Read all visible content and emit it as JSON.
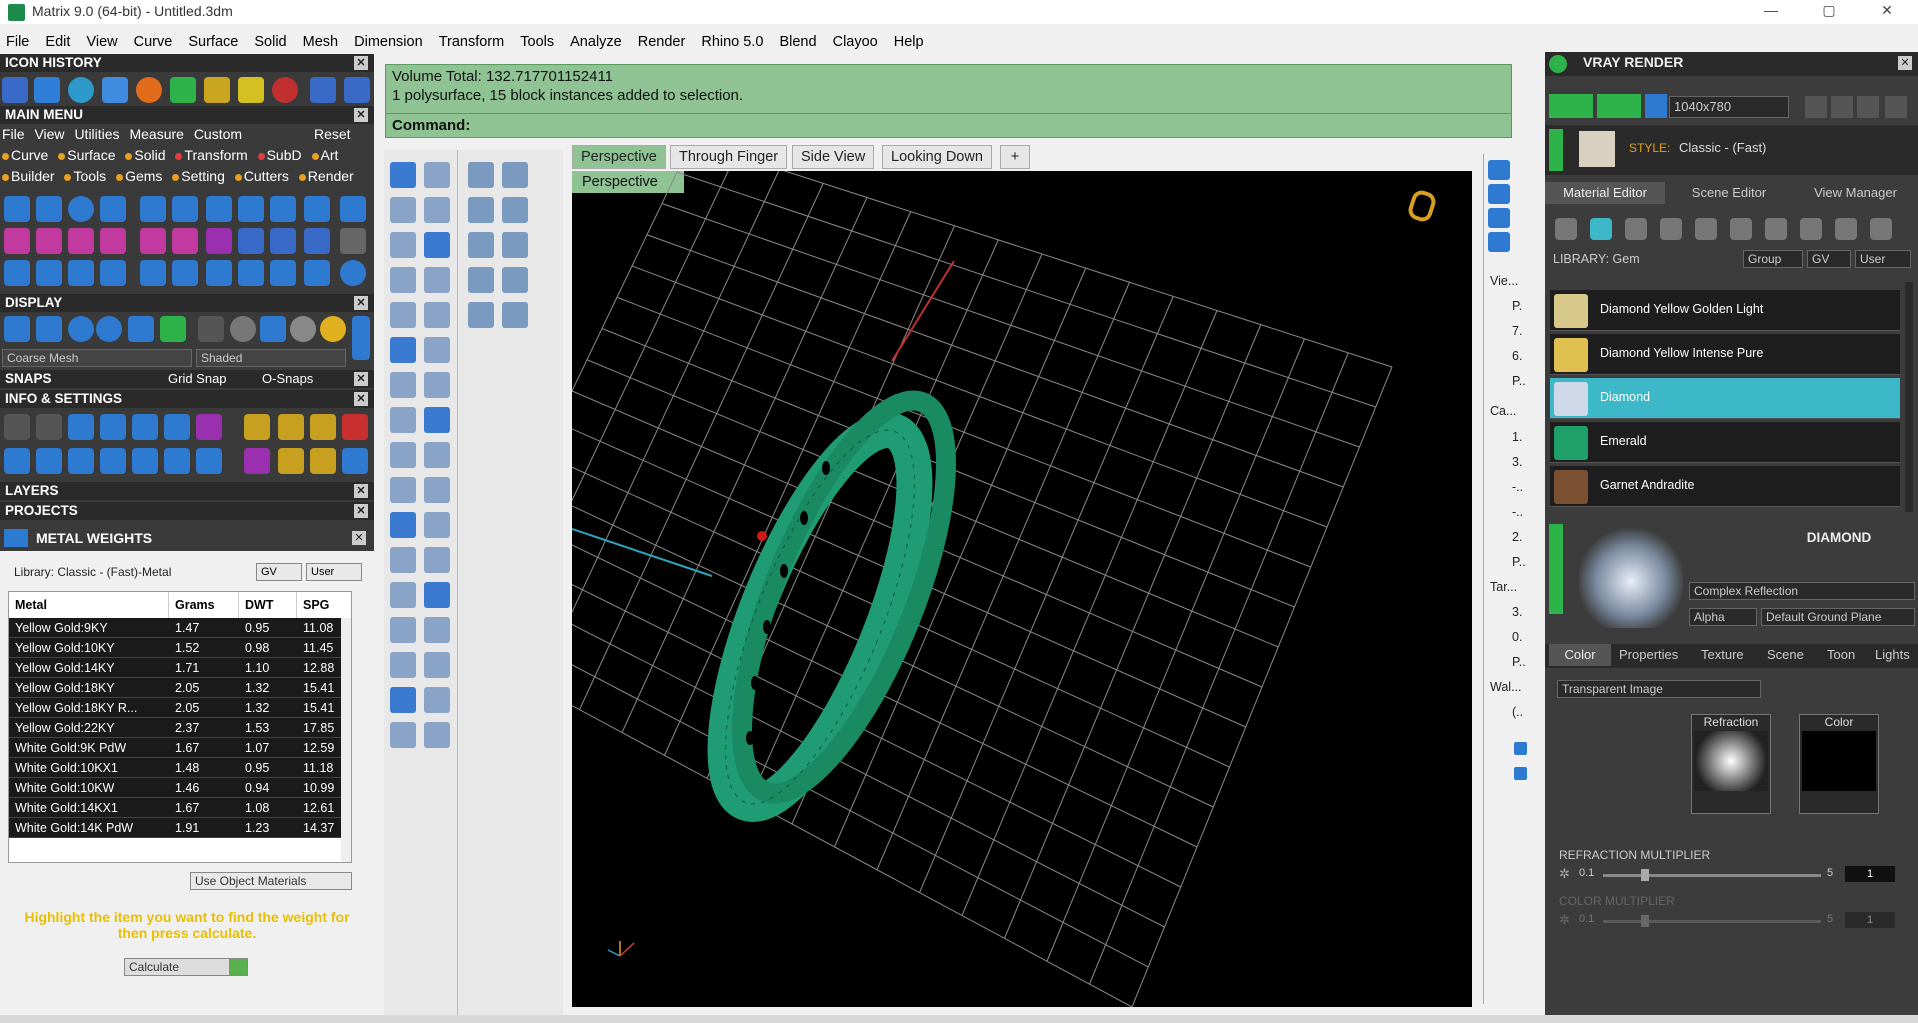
{
  "window": {
    "title": "Matrix 9.0 (64-bit) - Untitled.3dm",
    "minimize": "—",
    "maximize": "▢",
    "close": "✕"
  },
  "menubar": [
    "File",
    "Edit",
    "View",
    "Curve",
    "Surface",
    "Solid",
    "Mesh",
    "Dimension",
    "Transform",
    "Tools",
    "Analyze",
    "Render",
    "Rhino 5.0",
    "Blend",
    "Clayoo",
    "Help"
  ],
  "left": {
    "icon_history": "ICON HISTORY",
    "main_menu": "MAIN MENU",
    "main_menu_items": [
      "File",
      "View",
      "Utilities",
      "Measure",
      "Custom"
    ],
    "reset": "Reset",
    "categories_row1": [
      "Curve",
      "Surface",
      "Solid",
      "Transform",
      "SubD",
      "Art"
    ],
    "categories_row2": [
      "Builder",
      "Tools",
      "Gems",
      "Setting",
      "Cutters",
      "Render"
    ],
    "display": "DISPLAY",
    "mesh_select": "Coarse Mesh",
    "shade_select": "Shaded",
    "snaps": "SNAPS",
    "grid_snap": "Grid Snap",
    "osnaps": "O-Snaps",
    "info_settings": "INFO & SETTINGS",
    "layers": "LAYERS",
    "projects": "PROJECTS"
  },
  "metal_weights": {
    "title": "METAL WEIGHTS",
    "library": "Library: Classic - (Fast)-Metal",
    "gv": "GV",
    "user": "User",
    "columns": [
      "Metal",
      "Grams",
      "DWT",
      "SPG"
    ],
    "rows": [
      [
        "Yellow Gold:9KY",
        "1.47",
        "0.95",
        "11.08"
      ],
      [
        "Yellow Gold:10KY",
        "1.52",
        "0.98",
        "11.45"
      ],
      [
        "Yellow Gold:14KY",
        "1.71",
        "1.10",
        "12.88"
      ],
      [
        "Yellow Gold:18KY",
        "2.05",
        "1.32",
        "15.41"
      ],
      [
        "Yellow Gold:18KY R...",
        "2.05",
        "1.32",
        "15.41"
      ],
      [
        "Yellow Gold:22KY",
        "2.37",
        "1.53",
        "17.85"
      ],
      [
        "White Gold:9K PdW",
        "1.67",
        "1.07",
        "12.59"
      ],
      [
        "White Gold:10KX1",
        "1.48",
        "0.95",
        "11.18"
      ],
      [
        "White Gold:10KW",
        "1.46",
        "0.94",
        "10.99"
      ],
      [
        "White Gold:14KX1",
        "1.67",
        "1.08",
        "12.61"
      ],
      [
        "White Gold:14K PdW",
        "1.91",
        "1.23",
        "14.37"
      ]
    ],
    "use_object_materials": "Use Object Materials",
    "hint": "Highlight the item you want to find the weight for then press calculate.",
    "calculate": "Calculate"
  },
  "command": {
    "line1": "Volume Total: 132.717701152411",
    "line2": "1 polysurface, 15 block instances added to selection.",
    "label": "Command:"
  },
  "viewport": {
    "tabs": [
      "Perspective",
      "Through Finger",
      "Side View",
      "Looking Down"
    ],
    "add_tab": "+",
    "view_label": "Perspective"
  },
  "rightcol": {
    "items": [
      "Vie...",
      "P.",
      "7.",
      "6.",
      "P..",
      "Ca...",
      "1.",
      "3.",
      "-..",
      "-..",
      "2.",
      "P..",
      "Tar...",
      "3.",
      "0.",
      "P..",
      "Wal...",
      "(.."
    ]
  },
  "vray": {
    "title": "VRAY RENDER",
    "resolution": "1040x780",
    "style_label": "STYLE:",
    "style_value": "Classic - (Fast)",
    "tabs": [
      "Material Editor",
      "Scene Editor",
      "View Manager"
    ],
    "library": "LIBRARY: Gem",
    "group": "Group",
    "gv": "GV",
    "user": "User",
    "materials": [
      "Diamond Yellow Golden Light",
      "Diamond Yellow Intense Pure",
      "Diamond",
      "Emerald",
      "Garnet Andradite"
    ],
    "selected_name": "DIAMOND",
    "reflection": "Complex Reflection",
    "alpha": "Alpha",
    "ground": "Default Ground Plane",
    "prop_tabs": [
      "Color",
      "Properties",
      "Texture",
      "Scene",
      "Toon",
      "Lights"
    ],
    "transparent": "Transparent Image",
    "refraction": "Refraction",
    "color": "Color",
    "refraction_mult": "REFRACTION MULTIPLIER",
    "ref_min": "0.1",
    "ref_max": "5",
    "ref_val": "1",
    "color_mult": "COLOR MULTIPLIER",
    "col_min": "0.1",
    "col_max": "5",
    "col_val": "1"
  },
  "colors": {
    "accent": "#8fc393",
    "ring": "#1f9c73",
    "select": "#3cb8c8"
  }
}
